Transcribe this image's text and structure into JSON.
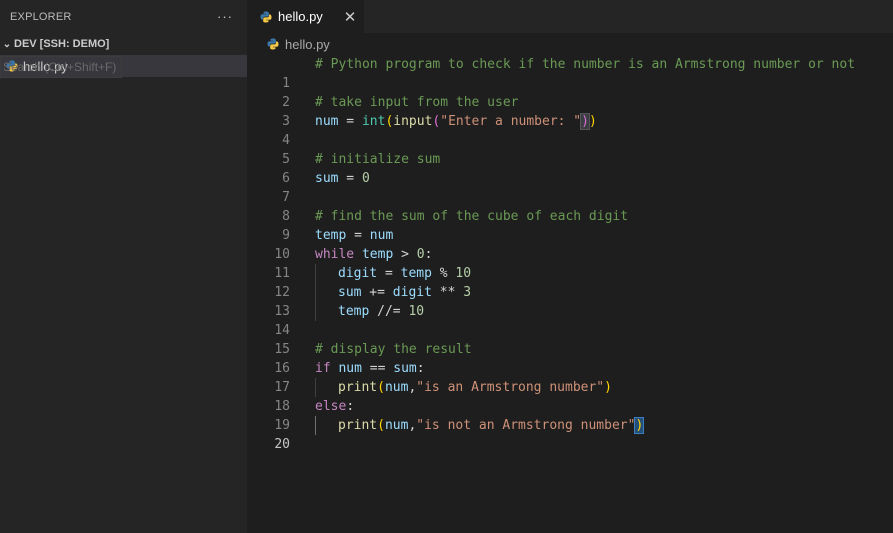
{
  "explorer": {
    "title": "EXPLORER",
    "more": "···",
    "folder": "DEV [SSH: DEMO]",
    "file": "hello.py",
    "search_hint": "Search (Ctrl+Shift+F)"
  },
  "tab": {
    "label": "hello.py",
    "close": "✕"
  },
  "breadcrumb": {
    "file": "hello.py"
  },
  "code": {
    "line_numbers": [
      "1",
      "2",
      "3",
      "4",
      "5",
      "6",
      "7",
      "8",
      "9",
      "10",
      "11",
      "12",
      "13",
      "14",
      "15",
      "16",
      "17",
      "18",
      "19",
      "20"
    ],
    "l1": "# Python program to check if the number is an Armstrong number or not",
    "l3": "# take input from the user",
    "l4_var": "num",
    "l4_eq": " = ",
    "l4_int": "int",
    "l4_p1": "(",
    "l4_input": "input",
    "l4_p2": "(",
    "l4_str": "\"Enter a number: \"",
    "l4_p3": ")",
    "l4_p4": ")",
    "l6": "# initialize sum",
    "l7_var": "sum",
    "l7_eq": " = ",
    "l7_num": "0",
    "l9": "# find the sum of the cube of each digit",
    "l10_var": "temp",
    "l10_eq": " = ",
    "l10_val": "num",
    "l11_kw": "while",
    "l11_var": " temp",
    "l11_op": " > ",
    "l11_num": "0",
    "l11_colon": ":",
    "l12_var": "digit",
    "l12_eq": " = ",
    "l12_var2": "temp",
    "l12_op": " % ",
    "l12_num": "10",
    "l13_var": "sum",
    "l13_op": " += ",
    "l13_var2": "digit",
    "l13_op2": " ** ",
    "l13_num": "3",
    "l14_var": "temp",
    "l14_op": " //= ",
    "l14_num": "10",
    "l16": "# display the result",
    "l17_kw": "if",
    "l17_var": " num",
    "l17_op": " == ",
    "l17_var2": "sum",
    "l17_colon": ":",
    "l18_fn": "print",
    "l18_p1": "(",
    "l18_var": "num",
    "l18_comma": ",",
    "l18_str": "\"is an Armstrong number\"",
    "l18_p2": ")",
    "l19_kw": "else",
    "l19_colon": ":",
    "l20_fn": "print",
    "l20_p1": "(",
    "l20_var": "num",
    "l20_comma": ",",
    "l20_str": "\"is not an Armstrong number\"",
    "l20_p2": ")"
  },
  "colors": {
    "comment": "#6a9955",
    "variable": "#9cdcfe",
    "function": "#dcdcaa",
    "string": "#ce9178",
    "number": "#b5cea8",
    "keyword": "#c586c0"
  }
}
